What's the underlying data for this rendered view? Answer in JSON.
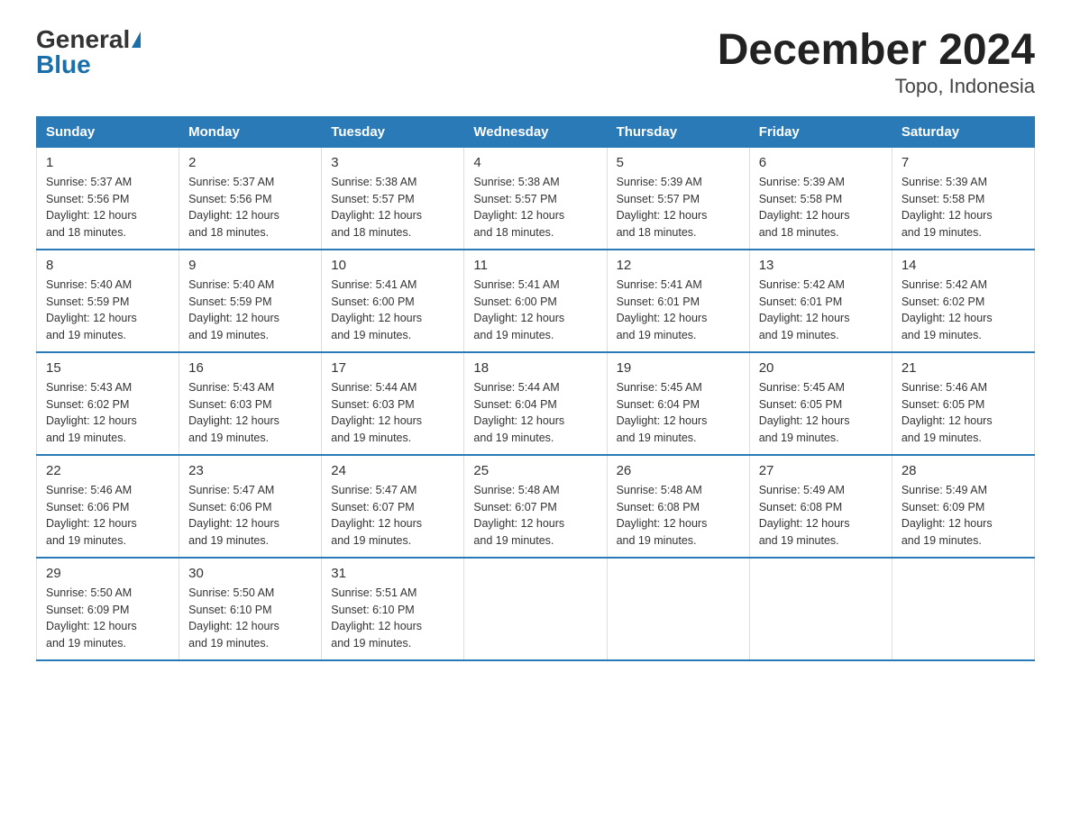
{
  "logo": {
    "text_general": "General",
    "text_blue": "Blue",
    "triangle_label": "logo-triangle"
  },
  "title": "December 2024",
  "subtitle": "Topo, Indonesia",
  "days_of_week": [
    "Sunday",
    "Monday",
    "Tuesday",
    "Wednesday",
    "Thursday",
    "Friday",
    "Saturday"
  ],
  "weeks": [
    [
      {
        "day": 1,
        "sunrise": "5:37 AM",
        "sunset": "5:56 PM",
        "daylight": "12 hours and 18 minutes."
      },
      {
        "day": 2,
        "sunrise": "5:37 AM",
        "sunset": "5:56 PM",
        "daylight": "12 hours and 18 minutes."
      },
      {
        "day": 3,
        "sunrise": "5:38 AM",
        "sunset": "5:57 PM",
        "daylight": "12 hours and 18 minutes."
      },
      {
        "day": 4,
        "sunrise": "5:38 AM",
        "sunset": "5:57 PM",
        "daylight": "12 hours and 18 minutes."
      },
      {
        "day": 5,
        "sunrise": "5:39 AM",
        "sunset": "5:57 PM",
        "daylight": "12 hours and 18 minutes."
      },
      {
        "day": 6,
        "sunrise": "5:39 AM",
        "sunset": "5:58 PM",
        "daylight": "12 hours and 18 minutes."
      },
      {
        "day": 7,
        "sunrise": "5:39 AM",
        "sunset": "5:58 PM",
        "daylight": "12 hours and 19 minutes."
      }
    ],
    [
      {
        "day": 8,
        "sunrise": "5:40 AM",
        "sunset": "5:59 PM",
        "daylight": "12 hours and 19 minutes."
      },
      {
        "day": 9,
        "sunrise": "5:40 AM",
        "sunset": "5:59 PM",
        "daylight": "12 hours and 19 minutes."
      },
      {
        "day": 10,
        "sunrise": "5:41 AM",
        "sunset": "6:00 PM",
        "daylight": "12 hours and 19 minutes."
      },
      {
        "day": 11,
        "sunrise": "5:41 AM",
        "sunset": "6:00 PM",
        "daylight": "12 hours and 19 minutes."
      },
      {
        "day": 12,
        "sunrise": "5:41 AM",
        "sunset": "6:01 PM",
        "daylight": "12 hours and 19 minutes."
      },
      {
        "day": 13,
        "sunrise": "5:42 AM",
        "sunset": "6:01 PM",
        "daylight": "12 hours and 19 minutes."
      },
      {
        "day": 14,
        "sunrise": "5:42 AM",
        "sunset": "6:02 PM",
        "daylight": "12 hours and 19 minutes."
      }
    ],
    [
      {
        "day": 15,
        "sunrise": "5:43 AM",
        "sunset": "6:02 PM",
        "daylight": "12 hours and 19 minutes."
      },
      {
        "day": 16,
        "sunrise": "5:43 AM",
        "sunset": "6:03 PM",
        "daylight": "12 hours and 19 minutes."
      },
      {
        "day": 17,
        "sunrise": "5:44 AM",
        "sunset": "6:03 PM",
        "daylight": "12 hours and 19 minutes."
      },
      {
        "day": 18,
        "sunrise": "5:44 AM",
        "sunset": "6:04 PM",
        "daylight": "12 hours and 19 minutes."
      },
      {
        "day": 19,
        "sunrise": "5:45 AM",
        "sunset": "6:04 PM",
        "daylight": "12 hours and 19 minutes."
      },
      {
        "day": 20,
        "sunrise": "5:45 AM",
        "sunset": "6:05 PM",
        "daylight": "12 hours and 19 minutes."
      },
      {
        "day": 21,
        "sunrise": "5:46 AM",
        "sunset": "6:05 PM",
        "daylight": "12 hours and 19 minutes."
      }
    ],
    [
      {
        "day": 22,
        "sunrise": "5:46 AM",
        "sunset": "6:06 PM",
        "daylight": "12 hours and 19 minutes."
      },
      {
        "day": 23,
        "sunrise": "5:47 AM",
        "sunset": "6:06 PM",
        "daylight": "12 hours and 19 minutes."
      },
      {
        "day": 24,
        "sunrise": "5:47 AM",
        "sunset": "6:07 PM",
        "daylight": "12 hours and 19 minutes."
      },
      {
        "day": 25,
        "sunrise": "5:48 AM",
        "sunset": "6:07 PM",
        "daylight": "12 hours and 19 minutes."
      },
      {
        "day": 26,
        "sunrise": "5:48 AM",
        "sunset": "6:08 PM",
        "daylight": "12 hours and 19 minutes."
      },
      {
        "day": 27,
        "sunrise": "5:49 AM",
        "sunset": "6:08 PM",
        "daylight": "12 hours and 19 minutes."
      },
      {
        "day": 28,
        "sunrise": "5:49 AM",
        "sunset": "6:09 PM",
        "daylight": "12 hours and 19 minutes."
      }
    ],
    [
      {
        "day": 29,
        "sunrise": "5:50 AM",
        "sunset": "6:09 PM",
        "daylight": "12 hours and 19 minutes."
      },
      {
        "day": 30,
        "sunrise": "5:50 AM",
        "sunset": "6:10 PM",
        "daylight": "12 hours and 19 minutes."
      },
      {
        "day": 31,
        "sunrise": "5:51 AM",
        "sunset": "6:10 PM",
        "daylight": "12 hours and 19 minutes."
      },
      null,
      null,
      null,
      null
    ]
  ]
}
